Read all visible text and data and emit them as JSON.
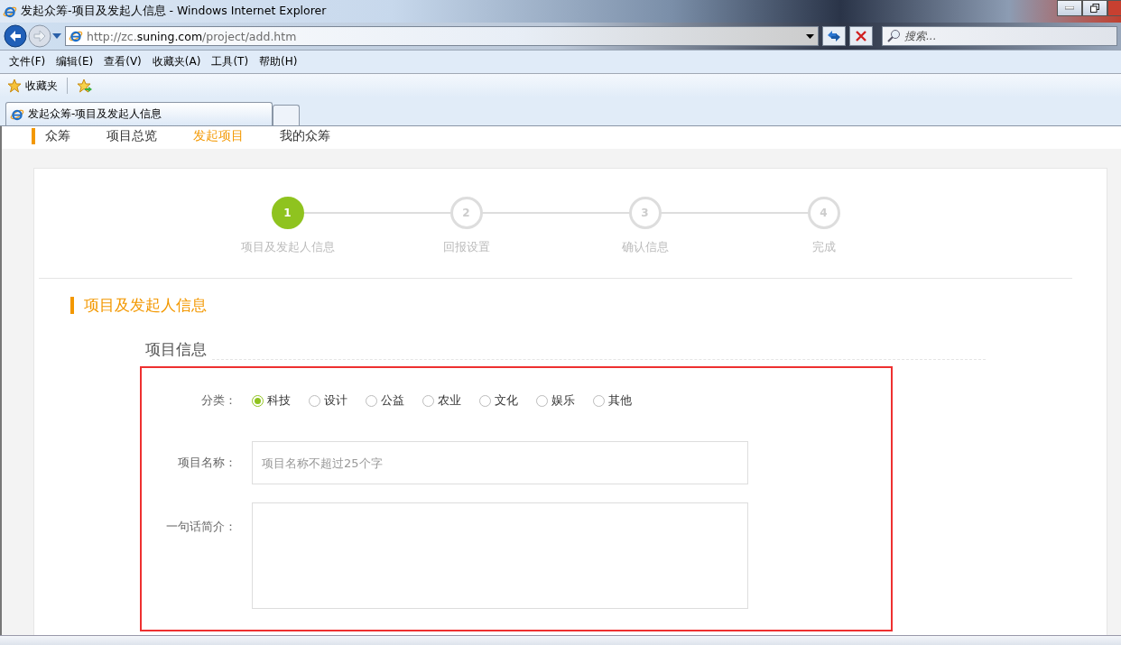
{
  "window": {
    "title": "发起众筹-项目及发起人信息 - Windows Internet Explorer"
  },
  "address_bar": {
    "url_prefix": "http://zc.",
    "url_domain": "suning.com",
    "url_path": "/project/add.htm"
  },
  "search": {
    "placeholder": "搜索..."
  },
  "menu_bar": [
    "文件(F)",
    "编辑(E)",
    "查看(V)",
    "收藏夹(A)",
    "工具(T)",
    "帮助(H)"
  ],
  "favorites_bar": {
    "label": "收藏夹"
  },
  "tabs": [
    {
      "label": "发起众筹-项目及发起人信息",
      "selected": true
    }
  ],
  "site_nav": [
    {
      "label": "众筹",
      "kind": "brand",
      "selected": false
    },
    {
      "label": "项目总览",
      "kind": "link",
      "selected": false
    },
    {
      "label": "发起项目",
      "kind": "link",
      "selected": true
    },
    {
      "label": "我的众筹",
      "kind": "link",
      "selected": false
    }
  ],
  "steps": [
    {
      "number": "1",
      "label": "项目及发起人信息",
      "selected": true
    },
    {
      "number": "2",
      "label": "回报设置",
      "selected": false
    },
    {
      "number": "3",
      "label": "确认信息",
      "selected": false
    },
    {
      "number": "4",
      "label": "完成",
      "selected": false
    }
  ],
  "section_title": "项目及发起人信息",
  "subsection_title": "项目信息",
  "form": {
    "category": {
      "label": "分类：",
      "options": [
        {
          "label": "科技",
          "selected": true
        },
        {
          "label": "设计",
          "selected": false
        },
        {
          "label": "公益",
          "selected": false
        },
        {
          "label": "农业",
          "selected": false
        },
        {
          "label": "文化",
          "selected": false
        },
        {
          "label": "娱乐",
          "selected": false
        },
        {
          "label": "其他",
          "selected": false
        }
      ]
    },
    "name": {
      "label": "项目名称：",
      "placeholder": "项目名称不超过25个字"
    },
    "summary": {
      "label": "一句话简介："
    }
  }
}
